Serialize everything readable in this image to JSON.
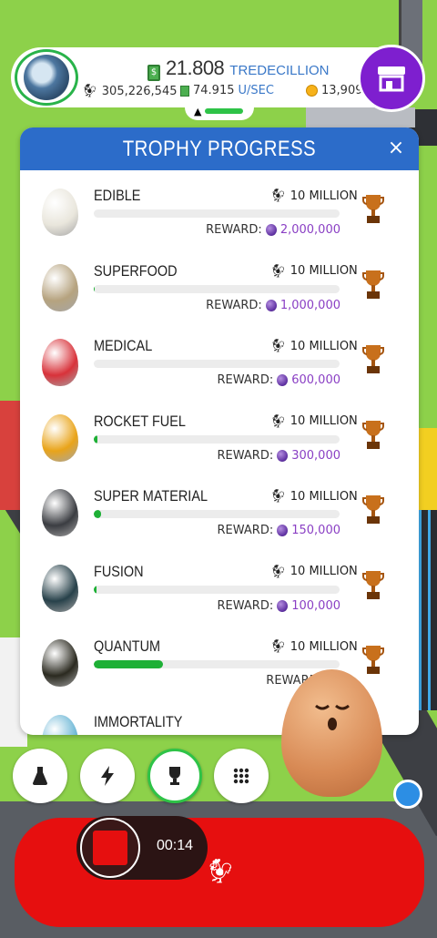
{
  "hud": {
    "cash_value": "21.808",
    "cash_unit": "TREDECILLION",
    "chickens": "305,226,545",
    "income_value": "74.915",
    "income_unit": "U/SEC",
    "golden_eggs": "13,909"
  },
  "modal": {
    "title": "TROPHY PROGRESS",
    "close_label": "×",
    "reward_label": "REWARD:",
    "rows": [
      {
        "name": "EDIBLE",
        "goal": "10 MILLION",
        "reward": "2,000,000",
        "progress": 0.0,
        "egg_color": "#e9e6dc"
      },
      {
        "name": "SUPERFOOD",
        "goal": "10 MILLION",
        "reward": "1,000,000",
        "progress": 0.005,
        "egg_color": "#b6a37f"
      },
      {
        "name": "MEDICAL",
        "goal": "10 MILLION",
        "reward": "600,000",
        "progress": 0.0,
        "egg_color": "#d8323a"
      },
      {
        "name": "ROCKET FUEL",
        "goal": "10 MILLION",
        "reward": "300,000",
        "progress": 0.015,
        "egg_color": "#e9a41a"
      },
      {
        "name": "SUPER MATERIAL",
        "goal": "10 MILLION",
        "reward": "150,000",
        "progress": 0.03,
        "egg_color": "#3b3d42"
      },
      {
        "name": "FUSION",
        "goal": "10 MILLION",
        "reward": "100,000",
        "progress": 0.012,
        "egg_color": "#27414a"
      },
      {
        "name": "QUANTUM",
        "goal": "10 MILLION",
        "reward": "",
        "progress": 0.28,
        "egg_color": "#2b2a20"
      },
      {
        "name": "IMMORTALITY",
        "goal": "",
        "reward": "",
        "progress": 0.0,
        "egg_color": "#6cb7d6"
      }
    ]
  },
  "recording": {
    "time": "00:14"
  },
  "toolbar": {
    "icons": [
      "flask-icon",
      "lightning-icon",
      "trophy-icon",
      "grid-icon"
    ]
  }
}
